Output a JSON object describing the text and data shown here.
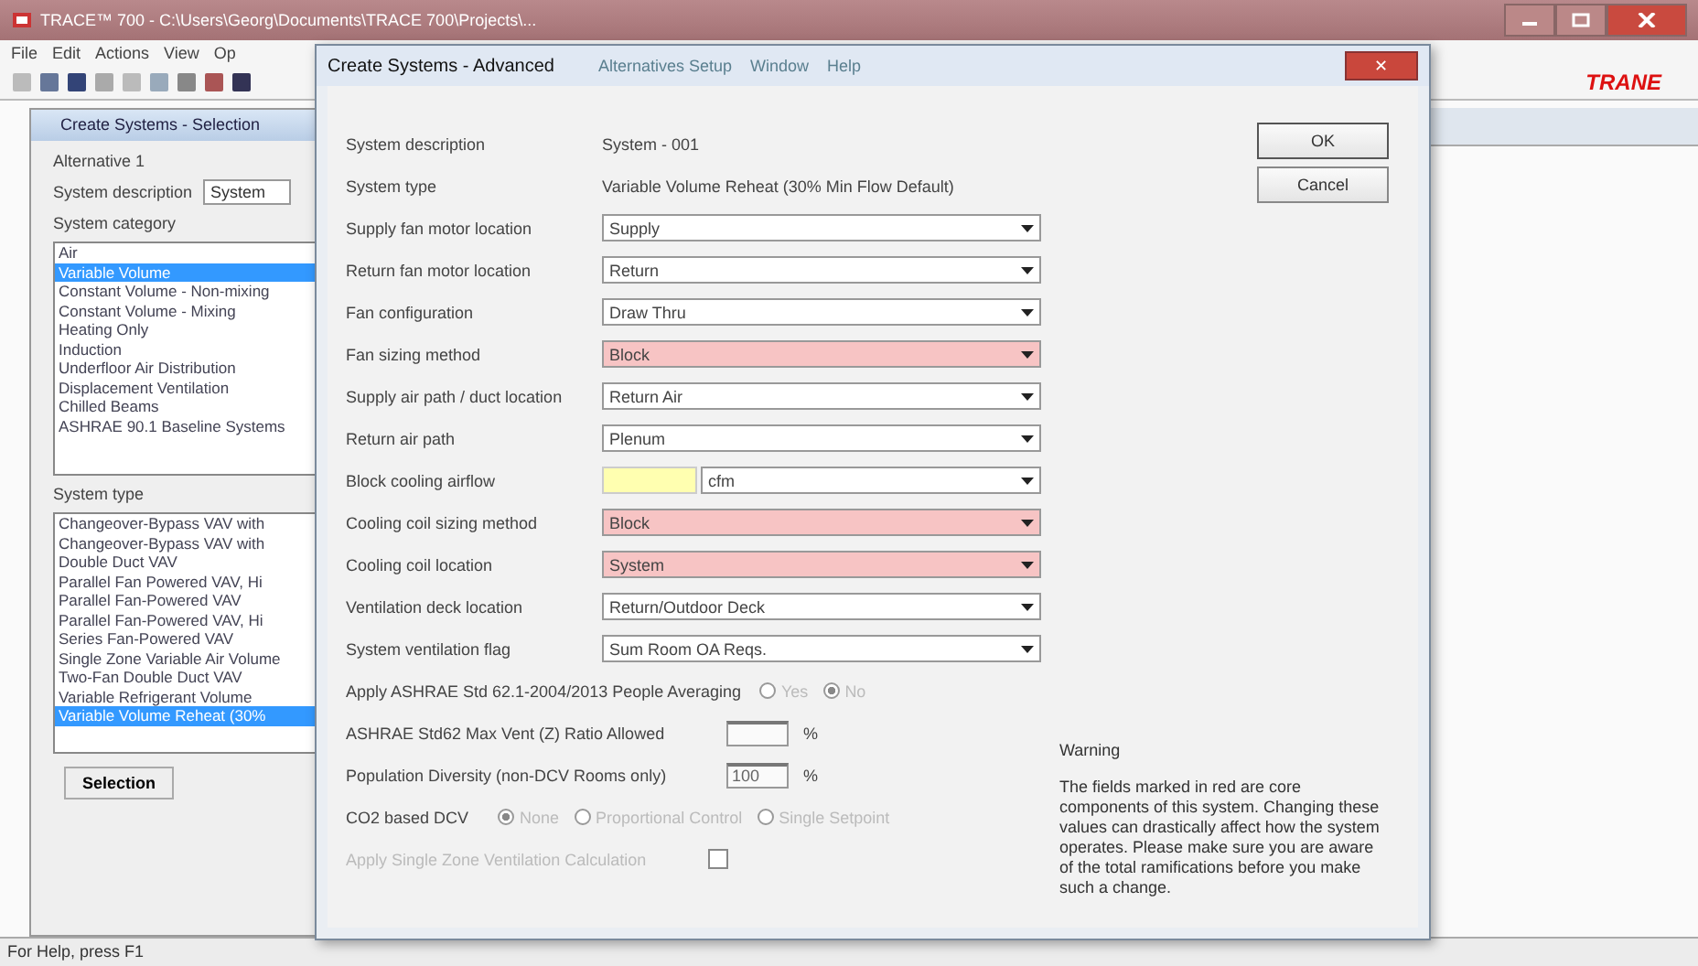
{
  "app": {
    "title": "TRACE™ 700 - C:\\Users\\Georg\\Documents\\TRACE 700\\Projects\\...",
    "menu": [
      "File",
      "Edit",
      "Actions",
      "View",
      "Op"
    ],
    "menu_behind": [
      "Alternatives Setup",
      "Window",
      "Help"
    ],
    "logo": "TRANE"
  },
  "selection_panel": {
    "title": "Create Systems - Selection",
    "alternative": "Alternative 1",
    "description_label": "System description",
    "description_value": "System",
    "category_label": "System category",
    "categories": [
      {
        "label": "Air",
        "selected": false
      },
      {
        "label": "Variable Volume",
        "selected": true
      },
      {
        "label": "Constant Volume - Non-mixing",
        "selected": false
      },
      {
        "label": "Constant Volume - Mixing",
        "selected": false
      },
      {
        "label": "Heating Only",
        "selected": false
      },
      {
        "label": "Induction",
        "selected": false
      },
      {
        "label": "Underfloor Air Distribution",
        "selected": false
      },
      {
        "label": "Displacement Ventilation",
        "selected": false
      },
      {
        "label": "Chilled Beams",
        "selected": false
      },
      {
        "label": "ASHRAE 90.1 Baseline Systems",
        "selected": false
      }
    ],
    "type_label": "System type",
    "types": [
      {
        "label": "Changeover-Bypass VAV with",
        "selected": false
      },
      {
        "label": "Changeover-Bypass VAV with",
        "selected": false
      },
      {
        "label": "Double Duct VAV",
        "selected": false
      },
      {
        "label": "Parallel Fan Powered VAV, Hi",
        "selected": false
      },
      {
        "label": "Parallel Fan-Powered VAV",
        "selected": false
      },
      {
        "label": "Parallel Fan-Powered VAV, Hi",
        "selected": false
      },
      {
        "label": "Series Fan-Powered VAV",
        "selected": false
      },
      {
        "label": "Single Zone Variable Air Volume",
        "selected": false
      },
      {
        "label": "Two-Fan Double Duct VAV",
        "selected": false
      },
      {
        "label": "Variable Refrigerant Volume",
        "selected": false
      },
      {
        "label": "Variable Volume Reheat (30%",
        "selected": true
      }
    ],
    "button": "Selection"
  },
  "dialog": {
    "title": "Create Systems - Advanced",
    "close": "✕",
    "info": [
      {
        "label": "System description",
        "value": "System - 001"
      },
      {
        "label": "System type",
        "value": "Variable Volume Reheat (30% Min Flow Default)"
      }
    ],
    "rows": [
      {
        "kind": "select",
        "label": "Supply fan motor location",
        "value": "Supply",
        "highlighted": false
      },
      {
        "kind": "select",
        "label": "Return fan motor location",
        "value": "Return",
        "highlighted": false
      },
      {
        "kind": "select",
        "label": "Fan configuration",
        "value": "Draw Thru",
        "highlighted": false
      },
      {
        "kind": "select",
        "label": "Fan sizing method",
        "value": "Block",
        "highlighted": true
      },
      {
        "kind": "select",
        "label": "Supply air path / duct location",
        "value": "Return Air",
        "highlighted": false
      },
      {
        "kind": "select",
        "label": "Return air path",
        "value": "Plenum",
        "highlighted": false
      },
      {
        "kind": "unit",
        "label": "Block cooling airflow",
        "value": "cfm",
        "highlighted": false
      },
      {
        "kind": "select",
        "label": "Cooling coil sizing method",
        "value": "Block",
        "highlighted": true
      },
      {
        "kind": "select",
        "label": "Cooling coil location",
        "value": "System",
        "highlighted": true
      },
      {
        "kind": "select",
        "label": "Ventilation deck location",
        "value": "Return/Outdoor Deck",
        "highlighted": false
      },
      {
        "kind": "select",
        "label": "System ventilation flag",
        "value": "Sum Room OA Reqs.",
        "highlighted": false
      }
    ],
    "averaging": {
      "label": "Apply ASHRAE Std 62.1-2004/2013 People Averaging",
      "disabled": true,
      "options": [
        {
          "label": "Yes",
          "selected": false
        },
        {
          "label": "No",
          "selected": true
        }
      ]
    },
    "percent_fields": [
      {
        "label": "ASHRAE Std62 Max Vent (Z) Ratio Allowed",
        "unit": "%"
      },
      {
        "label": "Population Diversity (non-DCV Rooms only)",
        "value": "100",
        "unit": "%"
      }
    ],
    "dcv": {
      "label": "CO2 based DCV",
      "disabled": true,
      "options": [
        {
          "label": "None",
          "selected": true
        },
        {
          "label": "Proportional Control",
          "selected": false
        },
        {
          "label": "Single Setpoint",
          "selected": false
        }
      ]
    },
    "single_zone": {
      "label": "Apply Single Zone Ventilation Calculation",
      "checked": false,
      "disabled": true
    },
    "buttons": [
      "OK",
      "Cancel"
    ],
    "warning_title": "Warning",
    "warning_text": "The fields marked in red are core components of this system. Changing these values can drastically affect how the system operates. Please make sure you are aware of the total ramifications before you make such a change."
  },
  "status_bar": "For Help, press F1"
}
